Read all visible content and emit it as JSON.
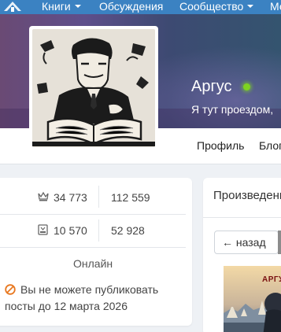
{
  "nav": {
    "items": [
      {
        "label": "Книги",
        "has_dropdown": true
      },
      {
        "label": "Обсуждения",
        "has_dropdown": false
      },
      {
        "label": "Сообщество",
        "has_dropdown": true
      },
      {
        "label": "Ме",
        "has_dropdown": false
      }
    ],
    "background": "#3b82c2"
  },
  "profile": {
    "name": "Аргус",
    "online": true,
    "status_text": "Я тут проездом,",
    "avatar_icon": "writer-at-desk-illustration"
  },
  "tabs": [
    {
      "label": "Профиль"
    },
    {
      "label": "Блог"
    }
  ],
  "stats": {
    "rows": [
      {
        "icon": "crown-icon",
        "left": "34 773",
        "right": "112 559"
      },
      {
        "icon": "book-icon",
        "left": "10 570",
        "right": "52 928"
      }
    ],
    "online_label": "Онлайн",
    "ban_text": "Вы не можете публиковать посты до 12 марта 2026",
    "ban_icon": "no-entry-icon"
  },
  "works": {
    "title": "Произведения",
    "back_label": "← назад",
    "book_title": "АРГУС"
  }
}
